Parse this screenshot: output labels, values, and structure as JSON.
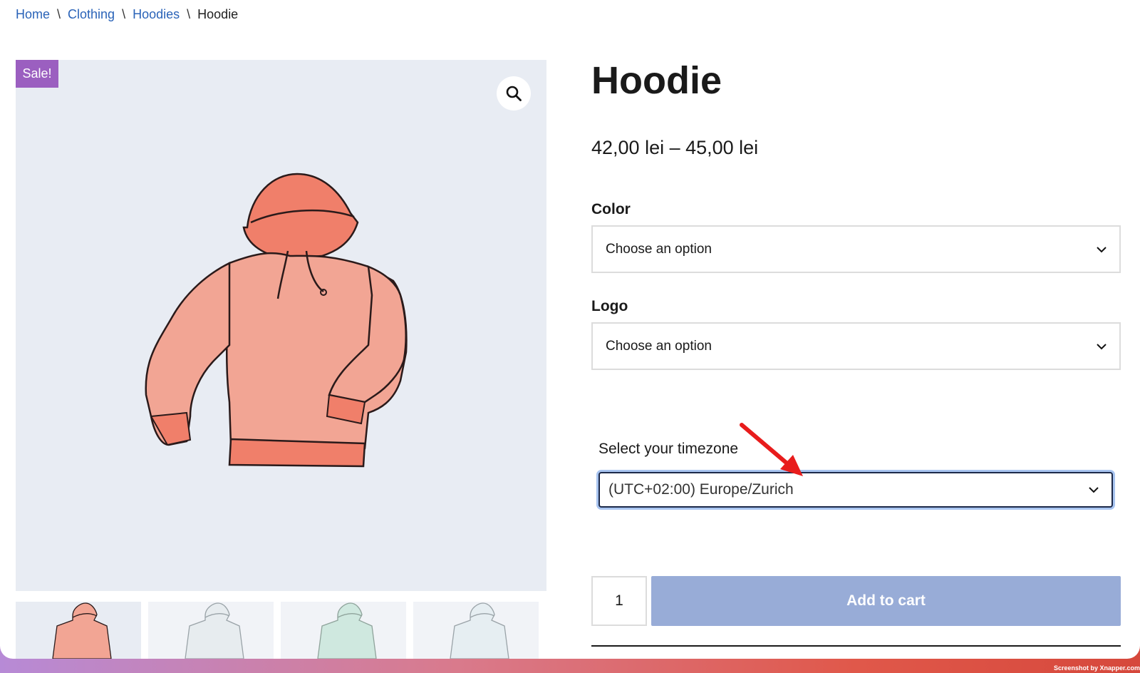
{
  "breadcrumb": {
    "home": "Home",
    "clothing": "Clothing",
    "hoodies": "Hoodies",
    "current": "Hoodie",
    "separator": "\\"
  },
  "gallery": {
    "sale_badge": "Sale!",
    "zoom_icon": "search-icon",
    "thumbnails": [
      "hoodie-red",
      "hoodie-grey",
      "hoodie-green",
      "hoodie-blue"
    ]
  },
  "product": {
    "title": "Hoodie",
    "price": "42,00 lei – 45,00 lei"
  },
  "variations": {
    "color_label": "Color",
    "color_value": "Choose an option",
    "logo_label": "Logo",
    "logo_value": "Choose an option"
  },
  "timezone": {
    "label": "Select your timezone",
    "value": "(UTC+02:00) Europe/Zurich"
  },
  "cart": {
    "quantity": "1",
    "add_label": "Add to cart"
  },
  "colors": {
    "link": "#2a63b8",
    "sale": "#9b5fc0",
    "button": "#98acd7",
    "arrow": "#e81c1c"
  },
  "footer": {
    "credit": "Screenshot by Xnapper.com"
  }
}
